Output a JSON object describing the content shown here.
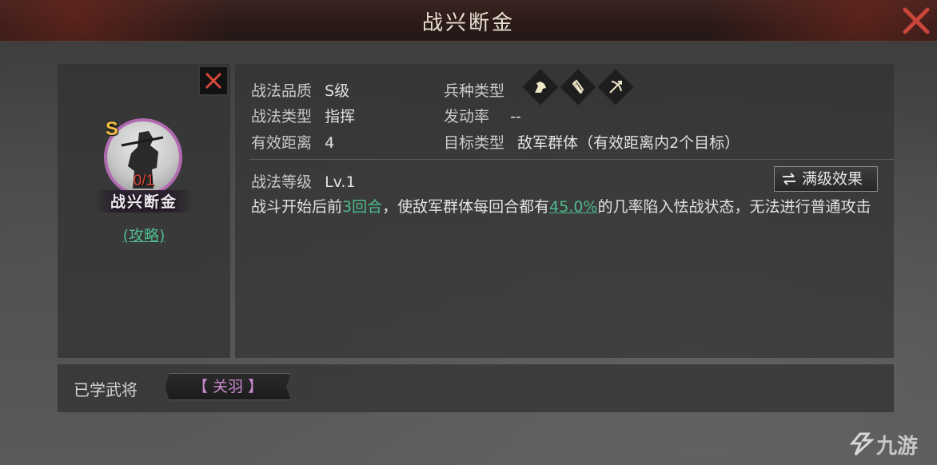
{
  "window": {
    "title": "战兴断金"
  },
  "skill": {
    "grade": "S",
    "learn_count": "0/1",
    "name": "战兴断金",
    "guide_link": "(攻略)"
  },
  "attributes": {
    "quality_label": "战法品质",
    "quality_value": "S级",
    "type_label": "战法类型",
    "type_value": "指挥",
    "range_label": "有效距离",
    "range_value": "4",
    "troop_label": "兵种类型",
    "trigger_label": "发动率",
    "trigger_value": "--",
    "target_label": "目标类型",
    "target_value": "敌军群体（有效距离内2个目标）",
    "troop_icons": [
      "cavalry-icon",
      "shield-icon",
      "bow-icon"
    ]
  },
  "level": {
    "label": "战法等级",
    "value": "Lv.1",
    "max_button": "满级效果"
  },
  "description": {
    "part1": "战斗开始后前",
    "rounds": "3回合",
    "part2": "，使敌军群体每回合都有",
    "chance": "45.0%",
    "part3": "的几率陷入怯战状态，无法进行普通攻击"
  },
  "learned": {
    "label": "已学武将",
    "generals": [
      "【 关羽 】"
    ]
  },
  "watermark": "九游",
  "colors": {
    "accent_green": "#4dbb8e",
    "grade_gold": "#f0c040",
    "count_red": "#e04a3a",
    "ring_purple": "#b06bb0"
  }
}
